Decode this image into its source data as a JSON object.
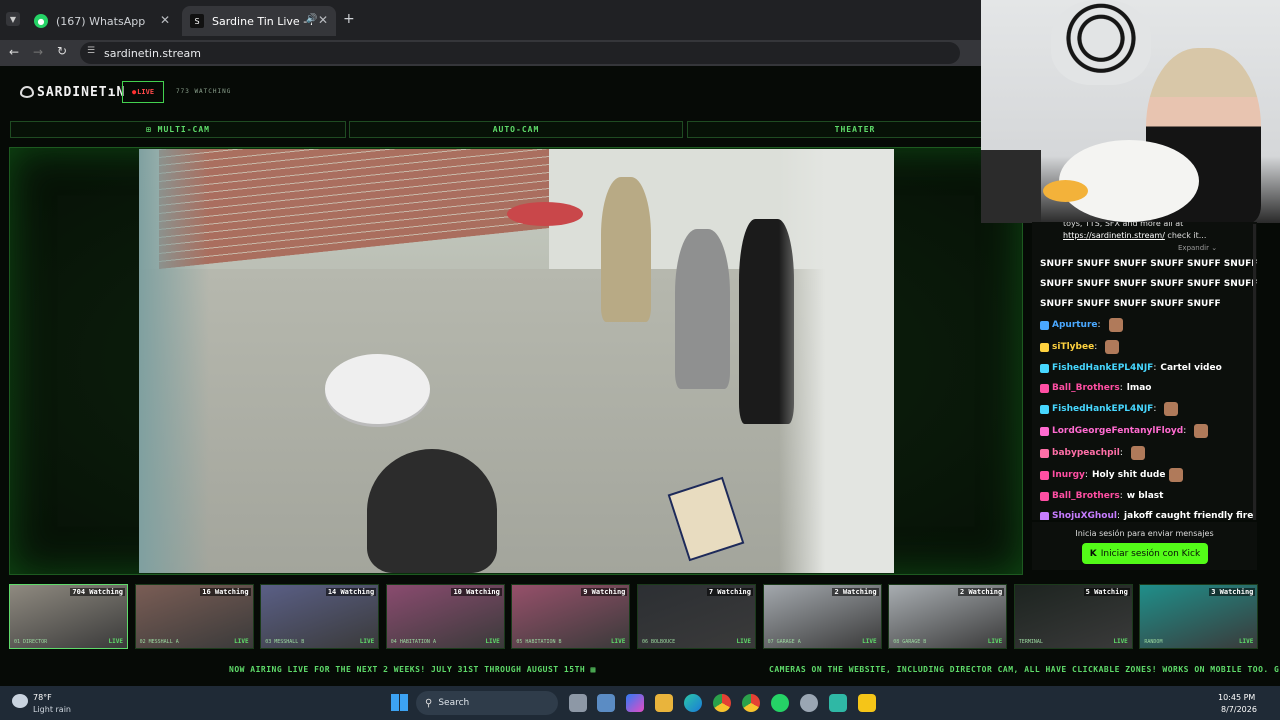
{
  "browser": {
    "tabs": [
      {
        "title": "(167) WhatsApp",
        "icon": "whatsapp-icon"
      },
      {
        "title": "Sardine Tin Live - All Rooms",
        "icon": "sardinetin-icon"
      }
    ],
    "url": "sardinetin.stream"
  },
  "site": {
    "logo": "SARDINETıN",
    "live_badge": "LIVE",
    "watching": "773 WATCHING",
    "nav": [
      {
        "label": "⊞ MULTI-CAM"
      },
      {
        "label": "AUTO-CAM"
      },
      {
        "label": "THEATER"
      }
    ]
  },
  "chat": {
    "top_text": "toys, TTS, SFX and more all at",
    "top_link": "https://sardinetin.stream/",
    "top_link_suffix": " check it...",
    "expand_label": "Expandir ⌄",
    "snuff_lines": [
      "SNUFF SNUFF SNUFF SNUFF SNUFF SNUFF",
      "SNUFF SNUFF SNUFF SNUFF SNUFF SNUFF",
      "SNUFF SNUFF SNUFF SNUFF SNUFF"
    ],
    "messages": [
      {
        "user": "Apurture",
        "text": "",
        "color": "#4aa8ff",
        "emote": true
      },
      {
        "user": "siTlybee",
        "text": "",
        "color": "#ffd23f",
        "emote": true
      },
      {
        "user": "FishedHankEPL4NJF",
        "text": "Cartel video",
        "color": "#47d7ff",
        "emote": false
      },
      {
        "user": "Ball_Brothers",
        "text": "lmao",
        "color": "#ff4fa3",
        "emote": false
      },
      {
        "user": "FishedHankEPL4NJF",
        "text": "",
        "color": "#47d7ff",
        "emote": true
      },
      {
        "user": "LordGeorgeFentanylFloyd",
        "text": "",
        "color": "#ff6bd0",
        "emote": true
      },
      {
        "user": "babypeachpil",
        "text": "",
        "color": "#ff6fa8",
        "emote": true
      },
      {
        "user": "Inurgy",
        "text": "Holy shit dude",
        "color": "#ff4fa3",
        "emote": true
      },
      {
        "user": "Ball_Brothers",
        "text": "w blast",
        "color": "#ff4fa3",
        "emote": false
      },
      {
        "user": "ShojuXGhoul",
        "text": "jakoff caught friendly fire",
        "color": "#c77dff",
        "emote": false
      }
    ],
    "login_prompt": "Inicia sesión para enviar mensajes",
    "login_button": "Iniciar sesión con Kick"
  },
  "thumbs": [
    {
      "watching": "704 Watching",
      "label": "01 DIRECTOR",
      "live": "LIVE",
      "color": "#8f8a80"
    },
    {
      "watching": "16 Watching",
      "label": "02 MESSHALL A",
      "live": "LIVE",
      "color": "#7a5d55"
    },
    {
      "watching": "14 Watching",
      "label": "03 MESSHALL B",
      "live": "LIVE",
      "color": "#5a5f86"
    },
    {
      "watching": "10 Watching",
      "label": "04 HABITATION A",
      "live": "LIVE",
      "color": "#8a4b6f"
    },
    {
      "watching": "9 Watching",
      "label": "05 HABITATION B",
      "live": "LIVE",
      "color": "#96506a"
    },
    {
      "watching": "7 Watching",
      "label": "06 BOLBOUCE",
      "live": "LIVE",
      "color": "#2c2f33"
    },
    {
      "watching": "2 Watching",
      "label": "07 GARAGE A",
      "live": "LIVE",
      "color": "#a3a8ad"
    },
    {
      "watching": "2 Watching",
      "label": "08 GARAGE B",
      "live": "LIVE",
      "color": "#a8adb1"
    },
    {
      "watching": "5 Watching",
      "label": "TERMINAL",
      "live": "LIVE",
      "color": "#1d2420"
    },
    {
      "watching": "3 Watching",
      "label": "RANDOM",
      "live": "LIVE",
      "color": "#1f8f8a"
    }
  ],
  "ticker": {
    "left": "NOW AIRING LIVE FOR THE NEXT 2 WEEKS! JULY 31ST THROUGH AUGUST 15TH ▦",
    "right": "CAMERAS ON THE WEBSITE, INCLUDING DIRECTOR CAM, ALL HAVE CLICKABLE ZONES! WORKS ON MOBILE TOO. GIVE IT A TR"
  },
  "taskbar": {
    "weather_temp": "78°F",
    "weather_desc": "Light rain",
    "search_placeholder": "Search",
    "time": "10:45 PM",
    "date": "8/7/2026"
  }
}
